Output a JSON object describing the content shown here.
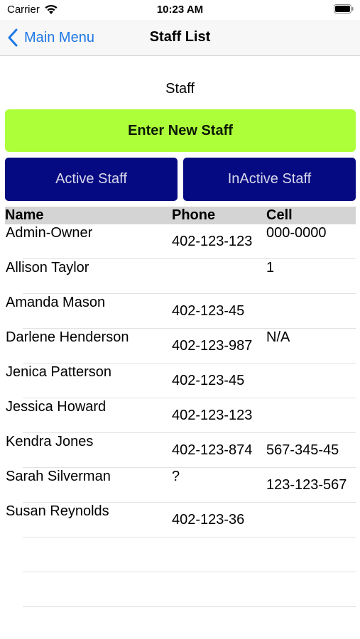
{
  "status_bar": {
    "carrier": "Carrier",
    "time": "10:23 AM",
    "wifi_icon": "wifi-icon",
    "battery_icon": "battery-icon"
  },
  "nav": {
    "back_label": "Main Menu",
    "back_icon": "chevron-left-icon",
    "title": "Staff List"
  },
  "section_label": "Staff",
  "buttons": {
    "enter_new": "Enter New Staff",
    "active": "Active Staff",
    "inactive": "InActive Staff"
  },
  "table": {
    "headers": {
      "name": "Name",
      "phone": "Phone",
      "cell": "Cell"
    },
    "rows": [
      {
        "name": "Admin-Owner",
        "phone": "402-123-123",
        "cell": "000-0000"
      },
      {
        "name": "Allison Taylor",
        "phone": "",
        "cell": "1"
      },
      {
        "name": "Amanda Mason",
        "phone": "402-123-45",
        "cell": ""
      },
      {
        "name": "Darlene Henderson",
        "phone": "402-123-987",
        "cell": "N/A"
      },
      {
        "name": "Jenica Patterson",
        "phone": "402-123-45",
        "cell": ""
      },
      {
        "name": "Jessica Howard",
        "phone": "402-123-123",
        "cell": ""
      },
      {
        "name": "Kendra Jones",
        "phone": "402-123-874",
        "cell": "567-345-45"
      },
      {
        "name": "Sarah Silverman",
        "phone": "?",
        "cell": "123-123-567"
      },
      {
        "name": "Susan Reynolds",
        "phone": "402-123-36",
        "cell": ""
      }
    ]
  },
  "colors": {
    "accent_blue": "#1e78e6",
    "new_button": "#adff3a",
    "nav_buttons": "#060a82",
    "header_gray": "#d4d4d4"
  }
}
